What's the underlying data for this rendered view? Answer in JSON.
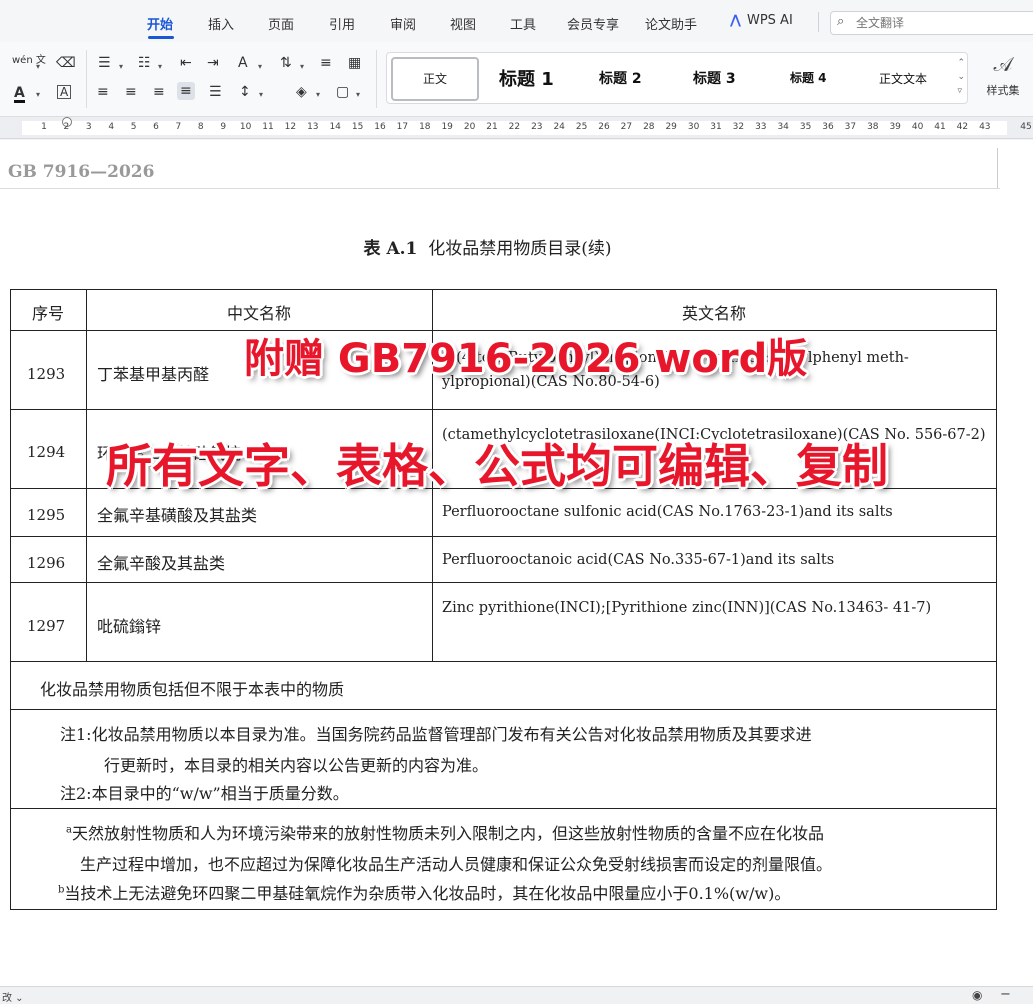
{
  "menu": {
    "tabs": [
      "开始",
      "插入",
      "页面",
      "引用",
      "审阅",
      "视图",
      "工具",
      "会员专享",
      "论文助手"
    ],
    "active_tab": "开始",
    "wps_ai": "WPS AI",
    "search_placeholder": "全文翻译"
  },
  "toolbar": {
    "icons": {
      "phonetic": "wén 文",
      "eraser": "⌫",
      "font_color": "A",
      "char_border": "A",
      "bullets": "☰",
      "numbering": "☷",
      "outdent": "⇤",
      "indent": "⇥",
      "text_direction": "A",
      "sort": "⇅",
      "line_spacing": "≡",
      "columns": "▦",
      "align_left": "≡",
      "align_center": "≡",
      "align_right": "≡",
      "justify": "≡",
      "distribute": "☰",
      "para_spacing": "↕",
      "shading": "◈",
      "borders": "▢"
    },
    "styles": [
      "正文",
      "标题 1",
      "标题 2",
      "标题 3",
      "标题 4",
      "正文文本"
    ],
    "style_set_label": "样式集"
  },
  "ruler": {
    "ticks": [
      "1",
      "2",
      "3",
      "4",
      "5",
      "6",
      "7",
      "8",
      "9",
      "10",
      "11",
      "12",
      "13",
      "14",
      "15",
      "16",
      "17",
      "18",
      "19",
      "20",
      "21",
      "22",
      "23",
      "24",
      "25",
      "26",
      "27",
      "28",
      "29",
      "30",
      "31",
      "32",
      "33",
      "34",
      "35",
      "36",
      "37",
      "38",
      "39",
      "40",
      "41",
      "42",
      "43",
      "45"
    ]
  },
  "document": {
    "header_code": "GB 7916—2026",
    "table_title_prefix": "表 A.1",
    "table_title_text": "化妆品禁用物质目录(续)",
    "columns": [
      "序号",
      "中文名称",
      "英文名称"
    ],
    "rows": [
      {
        "num": "1293",
        "cn": "丁苯基甲基丙醛",
        "en": "2-(4-tert-Butylbenzyl)propionaldehyde(INCI: Butylphenyl meth-ylpropional)(CAS  No.80-54-6)"
      },
      {
        "num": "1294",
        "cn": "环四聚二甲基硅氧烷",
        "en": "(ctamethylcyclotetrasiloxane(INCI:Cyclotetrasiloxane)(CAS No. 556-67-2)"
      },
      {
        "num": "1295",
        "cn": "全氟辛基磺酸及其盐类",
        "en": "Perfluorooctane sulfonic acid(CAS No.1763-23-1)and its salts"
      },
      {
        "num": "1296",
        "cn": "全氟辛酸及其盐类",
        "en": "Perfluorooctanoic acid(CAS No.335-67-1)and its  salts"
      },
      {
        "num": "1297",
        "cn": "吡硫鎓锌",
        "en": "Zinc pyrithione(INCI);[Pyrithione zinc(INN)](CAS No.13463- 41-7)"
      }
    ],
    "summary": "化妆品禁用物质包括但不限于本表中的物质",
    "notes": {
      "note1_line1": "注1:化妆品禁用物质以本目录为准。当国务院药品监督管理部门发布有关公告对化妆品禁用物质及其要求进",
      "note1_line2": "行更新时，本目录的相关内容以公告更新的内容为准。",
      "note2": "注2:本目录中的“w/w”相当于质量分数。"
    },
    "footnotes": {
      "a_mark": "a",
      "a_line1": "天然放射性物质和人为环境污染带来的放射性物质未列入限制之内，但这些放射性物质的含量不应在化妆品",
      "a_line2": "生产过程中增加，也不应超过为保障化妆品生产活动人员健康和保证公众免受射线损害而设定的剂量限值。",
      "b_mark": "b",
      "b_line1": "当技术上无法避免环四聚二甲基硅氧烷作为杂质带入化妆品时，其在化妆品中限量应小于0.1%(w/w)。"
    }
  },
  "watermark": {
    "line1": "附赠 GB7916-2026 word版",
    "line2": "所有文字、表格、公式均可编辑、复制",
    "color": "#e8162b"
  },
  "statusbar": {
    "left": "改 ⌄",
    "eye_icon": "◉",
    "zoom_out": "−"
  }
}
